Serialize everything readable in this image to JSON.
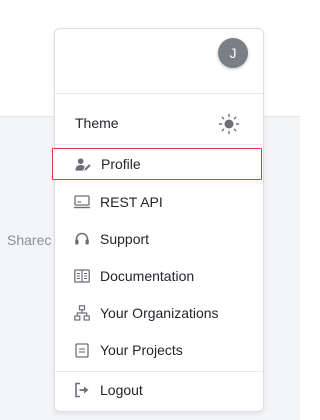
{
  "background": {
    "partial_text": "Sharec"
  },
  "user_menu": {
    "avatar_initial": "J",
    "theme_label": "Theme",
    "theme_icon": "sun-icon",
    "items": [
      {
        "label": "Profile",
        "icon": "user-edit-icon"
      },
      {
        "label": "REST API",
        "icon": "api-terminal-icon"
      },
      {
        "label": "Support",
        "icon": "headset-icon"
      },
      {
        "label": "Documentation",
        "icon": "book-icon"
      },
      {
        "label": "Your Organizations",
        "icon": "org-chart-icon"
      },
      {
        "label": "Your Projects",
        "icon": "project-icon"
      }
    ],
    "logout_label": "Logout",
    "logout_icon": "logout-icon"
  },
  "colors": {
    "highlight_border": "#e03b44",
    "avatar_bg": "#7a7f86",
    "text": "#22262b",
    "icon": "#6b7078"
  }
}
